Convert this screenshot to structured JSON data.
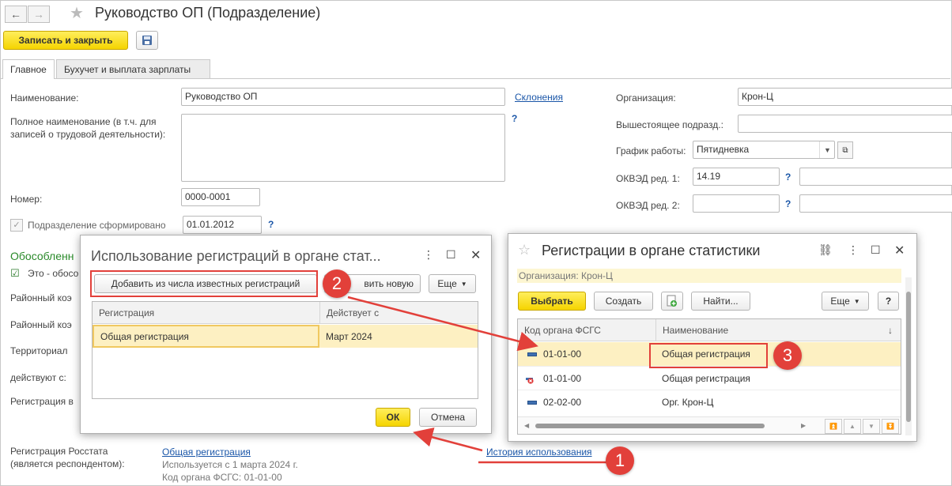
{
  "window": {
    "title": "Руководство ОП (Подразделение)",
    "back": "←",
    "forward": "→",
    "star": "★"
  },
  "toolbar": {
    "save_close": "Записать и закрыть",
    "save_icon": "floppy-disk-icon"
  },
  "tabs": [
    "Главное",
    "Бухучет и выплата зарплаты"
  ],
  "form": {
    "name_label": "Наименование:",
    "name_value": "Руководство ОП",
    "declensions": "Склонения",
    "fullname_label": "Полное наименование (в т.ч. для записей о трудовой деятельности):",
    "fullname_value": "",
    "qmark": "?",
    "number_label": "Номер:",
    "number_value": "0000-0001",
    "formed_label": "Подразделение сформировано",
    "formed_date": "01.01.2012",
    "separate_heading": "Обособленн",
    "separate_checkbox": "Это - обосо",
    "district_coef_1": "Районный коэ",
    "district_coef_2": "Районный коэ",
    "territorial": "Территориал",
    "acting_from": "действуют с:",
    "registration_in": "Регистрация в",
    "rosstat_label": "Регистрация Росстата (является респондентом):",
    "rosstat_link": "Общая регистрация",
    "rosstat_used": "Используется с 1 марта 2024 г.",
    "rosstat_code": "Код органа ФСГС: 01-01-00",
    "history_link": "История использования",
    "org_label": "Организация:",
    "org_value": "Крон-Ц",
    "parent_label": "Вышестоящее подразд.:",
    "parent_value": "",
    "schedule_label": "График работы:",
    "schedule_value": "Пятидневка",
    "okved1_label": "ОКВЭД ред. 1:",
    "okved1_value": "14.19",
    "okved2_label": "ОКВЭД ред. 2:",
    "okved2_value": ""
  },
  "dialog_usage": {
    "title": "Использование регистраций в органе стат...",
    "add_known": "Добавить из числа известных регистраций",
    "add_new": "вить новую",
    "more": "Еще",
    "col_registration": "Регистрация",
    "col_active_from": "Действует с",
    "rows": [
      {
        "registration": "Общая регистрация",
        "active_from": "Март 2024"
      }
    ],
    "ok": "ОК",
    "cancel": "Отмена"
  },
  "dialog_stats": {
    "title": "Регистрации в органе статистики",
    "org_line": "Организация: Крон-Ц",
    "select": "Выбрать",
    "create": "Создать",
    "find": "Найти...",
    "more": "Еще",
    "help": "?",
    "col_code": "Код органа ФСГС",
    "col_name": "Наименование",
    "sort_arrow": "↓",
    "rows": [
      {
        "code": "01-01-00",
        "name": "Общая регистрация",
        "status": "active"
      },
      {
        "code": "01-01-00",
        "name": "Общая регистрация",
        "status": "deleted"
      },
      {
        "code": "02-02-00",
        "name": "Орг. Крон-Ц",
        "status": "active"
      }
    ]
  },
  "markers": [
    "1",
    "2",
    "3"
  ],
  "colors": {
    "accent_yellow": "#f5d400",
    "selected_row": "#fdf0c2",
    "link": "#1a56a8",
    "annotation_red": "#e2403a"
  }
}
